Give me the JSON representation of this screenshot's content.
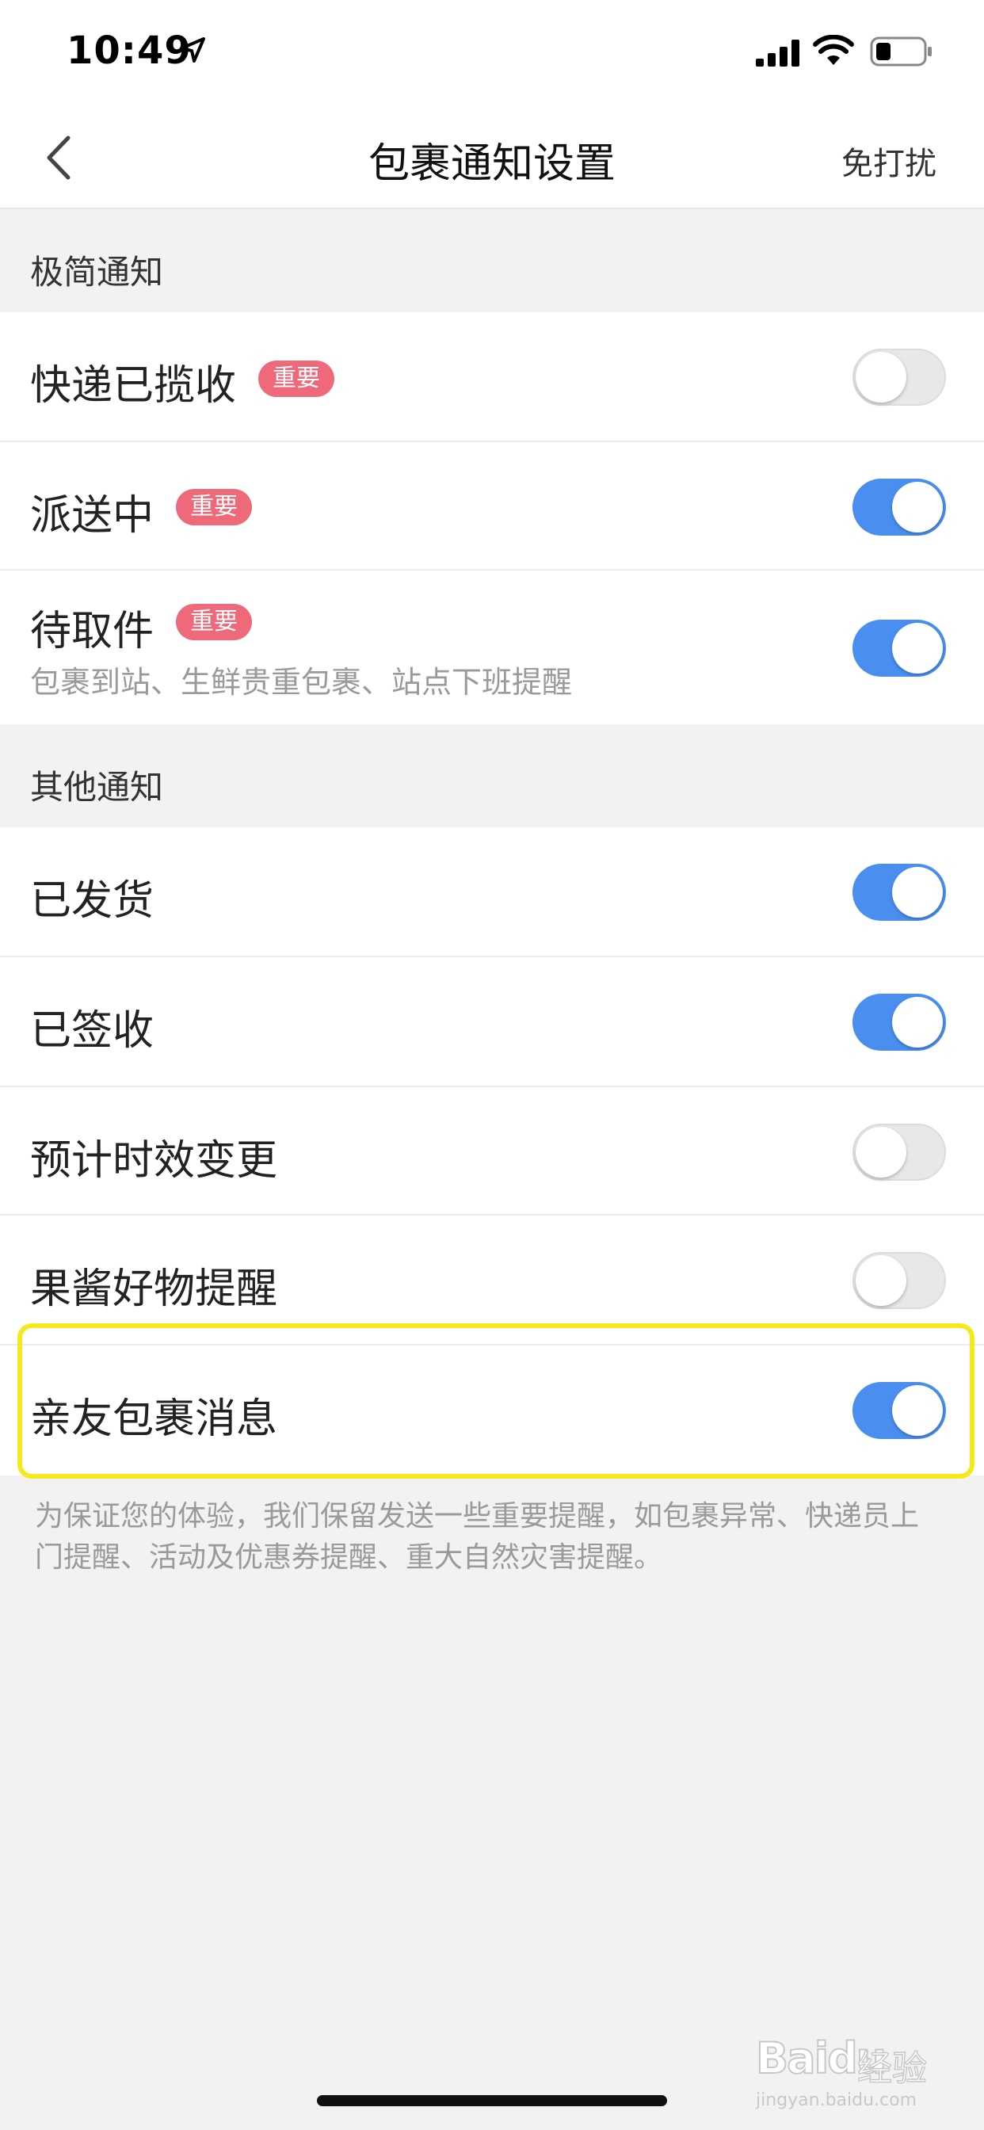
{
  "status_bar": {
    "time": "10:49"
  },
  "nav": {
    "title": "包裹通知设置",
    "right_action": "免打扰"
  },
  "sections": {
    "minimal": {
      "title": "极简通知"
    },
    "other": {
      "title": "其他通知"
    }
  },
  "rows": {
    "collected": {
      "label": "快递已揽收",
      "badge": "重要",
      "toggle": "off"
    },
    "delivering": {
      "label": "派送中",
      "badge": "重要",
      "toggle": "on"
    },
    "pickup": {
      "label": "待取件",
      "badge": "重要",
      "subtitle": "包裹到站、生鲜贵重包裹、站点下班提醒",
      "toggle": "on"
    },
    "shipped": {
      "label": "已发货",
      "toggle": "on"
    },
    "signed": {
      "label": "已签收",
      "toggle": "on"
    },
    "eta_change": {
      "label": "预计时效变更",
      "toggle": "off"
    },
    "goods_reminder": {
      "label": "果酱好物提醒",
      "toggle": "off"
    },
    "family_parcel": {
      "label": "亲友包裹消息",
      "toggle": "on"
    }
  },
  "footnote": "为保证您的体验，我们保留发送一些重要提醒，如包裹异常、快递员上门提醒、活动及优惠券提醒、重大自然灾害提醒。",
  "watermark": {
    "logo": "Baidu",
    "logo_cn": "经验",
    "url": "jingyan.baidu.com"
  },
  "colors": {
    "toggle_on": "#4a8ff0",
    "toggle_off": "#e8e8e8",
    "badge": "#ee6a7a",
    "highlight": "#f2ea1a"
  }
}
